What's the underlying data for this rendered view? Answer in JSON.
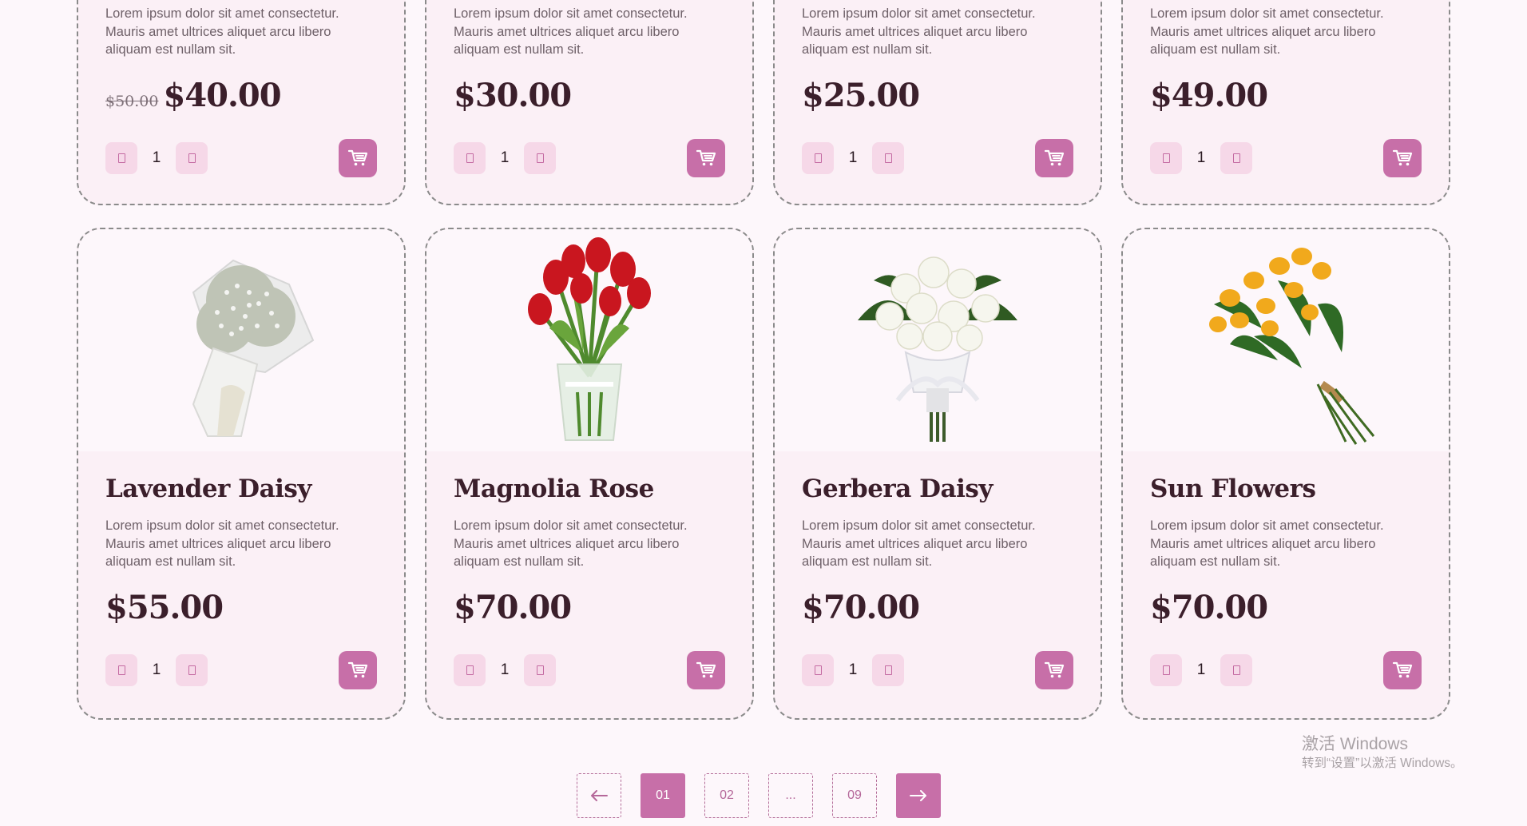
{
  "colors": {
    "accent": "#c76fa8",
    "card_bg": "#fbf0f6",
    "page_bg": "#fdf7fb",
    "title": "#3b1f2b"
  },
  "top_row": [
    {
      "description": "Lorem ipsum dolor sit amet consectetur. Mauris amet ultrices aliquet arcu libero aliquam est nullam sit.",
      "old_price": "$50.00",
      "price": "$40.00",
      "quantity": "1"
    },
    {
      "description": "Lorem ipsum dolor sit amet consectetur. Mauris amet ultrices aliquet arcu libero aliquam est nullam sit.",
      "price": "$30.00",
      "quantity": "1"
    },
    {
      "description": "Lorem ipsum dolor sit amet consectetur. Mauris amet ultrices aliquet arcu libero aliquam est nullam sit.",
      "price": "$25.00",
      "quantity": "1"
    },
    {
      "description": "Lorem ipsum dolor sit amet consectetur. Mauris amet ultrices aliquet arcu libero aliquam est nullam sit.",
      "price": "$49.00",
      "quantity": "1"
    }
  ],
  "bottom_row": [
    {
      "name": "Lavender Daisy",
      "description": "Lorem ipsum dolor sit amet consectetur. Mauris amet ultrices aliquet arcu libero aliquam est nullam sit.",
      "price": "$55.00",
      "quantity": "1",
      "image_icon": "white-gypsophila-bouquet"
    },
    {
      "name": "Magnolia Rose",
      "description": "Lorem ipsum dolor sit amet consectetur. Mauris amet ultrices aliquet arcu libero aliquam est nullam sit.",
      "price": "$70.00",
      "quantity": "1",
      "image_icon": "red-tulips-in-vase"
    },
    {
      "name": "Gerbera Daisy",
      "description": "Lorem ipsum dolor sit amet consectetur. Mauris amet ultrices aliquet arcu libero aliquam est nullam sit.",
      "price": "$70.00",
      "quantity": "1",
      "image_icon": "white-rose-bouquet"
    },
    {
      "name": "Sun Flowers",
      "description": "Lorem ipsum dolor sit amet consectetur. Mauris amet ultrices aliquet arcu libero aliquam est nullam sit.",
      "price": "$70.00",
      "quantity": "1",
      "image_icon": "yellow-rose-bouquet"
    }
  ],
  "icons": {
    "decrement": "minus-icon",
    "increment": "plus-icon",
    "cart": "cart-icon"
  },
  "pagination": {
    "prev": "prev-arrow-icon",
    "pages": [
      "01",
      "02",
      "...",
      "09"
    ],
    "active": "01",
    "next": "next-arrow-icon"
  },
  "watermark": {
    "line1": "激活 Windows",
    "line2": "转到“设置”以激活 Windows。"
  }
}
